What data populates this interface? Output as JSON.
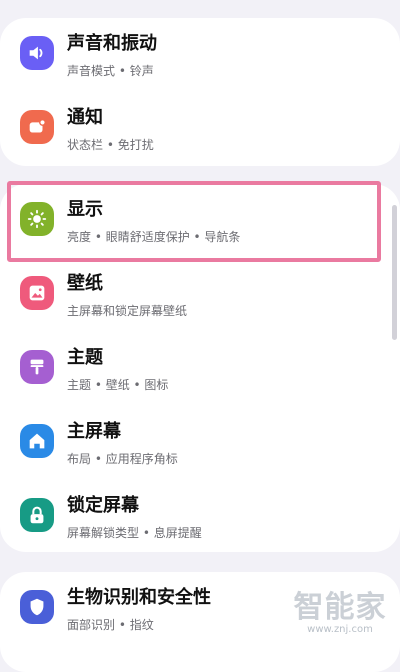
{
  "groups": [
    {
      "items": [
        {
          "title": "声音和振动",
          "subtitle": "声音模式 • 铃声",
          "icon": "speaker-icon",
          "color": "#6a5ff5"
        },
        {
          "title": "通知",
          "subtitle": "状态栏 • 免打扰",
          "icon": "notification-icon",
          "color": "#f06a4e"
        }
      ]
    },
    {
      "items": [
        {
          "title": "显示",
          "subtitle": "亮度 • 眼睛舒适度保护 • 导航条",
          "icon": "sun-icon",
          "color": "#82b22a"
        },
        {
          "title": "壁纸",
          "subtitle": "主屏幕和锁定屏幕壁纸",
          "icon": "wallpaper-icon",
          "color": "#ef5a7c"
        },
        {
          "title": "主题",
          "subtitle": "主题 • 壁纸 • 图标",
          "icon": "brush-icon",
          "color": "#a55fd1"
        },
        {
          "title": "主屏幕",
          "subtitle": "布局 • 应用程序角标",
          "icon": "home-icon",
          "color": "#2a8ae6"
        },
        {
          "title": "锁定屏幕",
          "subtitle": "屏幕解锁类型 • 息屏提醒",
          "icon": "lock-icon",
          "color": "#179b85"
        }
      ]
    },
    {
      "items": [
        {
          "title": "生物识别和安全性",
          "subtitle": "面部识别 • 指纹",
          "icon": "shield-icon",
          "color": "#4a5fd8"
        }
      ]
    }
  ],
  "watermark": {
    "text": "智能家",
    "url": "www.znj.com"
  }
}
